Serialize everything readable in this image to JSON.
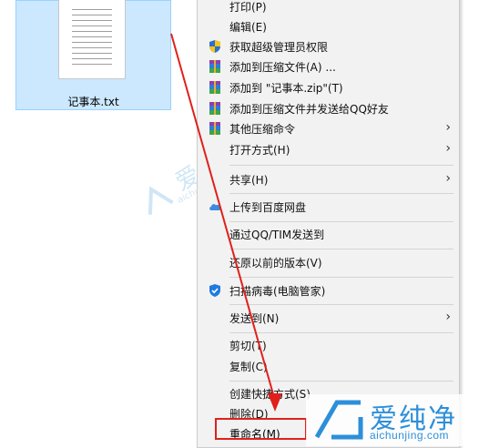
{
  "file": {
    "name": "记事本.txt"
  },
  "menu": {
    "items": [
      {
        "label": "打印(P)",
        "icon": "none"
      },
      {
        "label": "编辑(E)",
        "icon": "none"
      },
      {
        "label": "获取超级管理员权限",
        "icon": "uac-shield-icon"
      },
      {
        "label": "添加到压缩文件(A) ...",
        "icon": "winrar-icon"
      },
      {
        "label": "添加到 \"记事本.zip\"(T)",
        "icon": "winrar-icon"
      },
      {
        "label": "添加到压缩文件并发送给QQ好友",
        "icon": "winrar-icon"
      },
      {
        "label": "其他压缩命令",
        "icon": "winrar-icon",
        "submenu": true
      },
      {
        "label": "打开方式(H)",
        "icon": "none",
        "submenu": true
      },
      {
        "label": "共享(H)",
        "icon": "none",
        "submenu": true
      },
      {
        "label": "上传到百度网盘",
        "icon": "cloud-icon"
      },
      {
        "label": "通过QQ/TIM发送到",
        "icon": "none"
      },
      {
        "label": "还原以前的版本(V)",
        "icon": "none"
      },
      {
        "label": "扫描病毒(电脑管家)",
        "icon": "shield-check-icon"
      },
      {
        "label": "发送到(N)",
        "icon": "none",
        "submenu": true
      },
      {
        "label": "剪切(T)",
        "icon": "none"
      },
      {
        "label": "复制(C)",
        "icon": "none"
      },
      {
        "label": "创建快捷方式(S)",
        "icon": "none"
      },
      {
        "label": "删除(D)",
        "icon": "none"
      },
      {
        "label": "重命名(M)",
        "icon": "none",
        "highlighted": true
      }
    ],
    "chevron": "›"
  },
  "watermark": {
    "brand": "爱纯净",
    "url": "aichunjing.com",
    "mid_text": "爱纯净",
    "mid_url": "aichunjing.com"
  },
  "colors": {
    "menu_bg": "#f2f2f2",
    "selection_bg": "#cce8ff",
    "annotation_red": "#e0201c",
    "watermark_blue": "#2d8fd9"
  }
}
